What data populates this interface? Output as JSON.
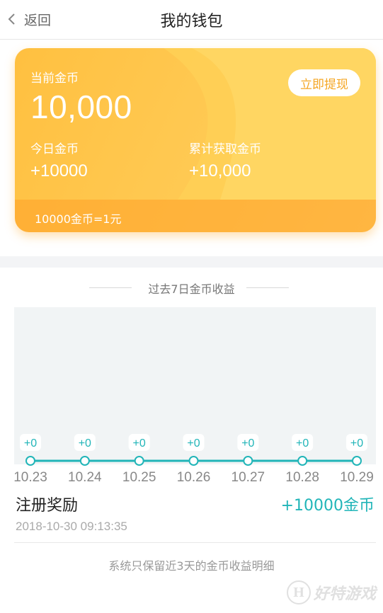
{
  "nav": {
    "back_label": "返回",
    "title": "我的钱包"
  },
  "card": {
    "current_label": "当前金币",
    "current_value": "10,000",
    "withdraw_label": "立即提现",
    "today_label": "今日金币",
    "today_value": "+10000",
    "total_label": "累计获取金币",
    "total_value": "+10,000",
    "rate_text": "10000金币=1元"
  },
  "chart_section": {
    "title": "过去7日金币收益"
  },
  "chart_data": {
    "type": "line",
    "x": [
      "10.23",
      "10.24",
      "10.25",
      "10.26",
      "10.27",
      "10.28",
      "10.29"
    ],
    "values": [
      0,
      0,
      0,
      0,
      0,
      0,
      0
    ],
    "data_labels": [
      "+0",
      "+0",
      "+0",
      "+0",
      "+0",
      "+0",
      "+0"
    ],
    "line_color": "#21b5b8"
  },
  "record": {
    "title": "注册奖励",
    "amount": "+10000金币",
    "time": "2018-10-30 09:13:35"
  },
  "note": "系统只保留近3天的金币收益明细",
  "watermark": {
    "logo_letter": "H",
    "text": "好特游戏"
  },
  "colors": {
    "accent": "#21b5b8",
    "card": "#ffc040",
    "withdraw_text": "#f5a623"
  }
}
